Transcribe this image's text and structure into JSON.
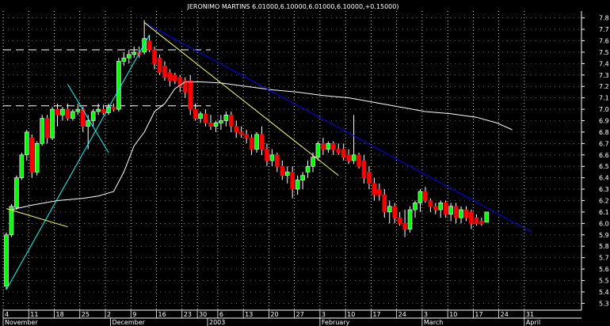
{
  "chart_data": {
    "type": "candlestick",
    "title": "JERONIMO MARTINS 6.01000,6.10000,6.01000,6.10000,+0.15000)",
    "xlabel": "",
    "ylabel": "",
    "ylim": [
      5.24,
      7.86
    ],
    "grid": true,
    "background": "#000000",
    "y_ticks": [
      7.8,
      7.7,
      7.6,
      7.5,
      7.4,
      7.3,
      7.2,
      7.1,
      7.0,
      6.9,
      6.8,
      6.7,
      6.6,
      6.5,
      6.4,
      6.3,
      6.2,
      6.1,
      6.0,
      5.9,
      5.8,
      5.7,
      5.6,
      5.5,
      5.4,
      5.3
    ],
    "x_day_labels": [
      {
        "label": "4",
        "session": 0
      },
      {
        "label": "11",
        "session": 5
      },
      {
        "label": "18",
        "session": 10
      },
      {
        "label": "25",
        "session": 15
      },
      {
        "label": "2",
        "session": 20
      },
      {
        "label": "9",
        "session": 25
      },
      {
        "label": "16",
        "session": 30
      },
      {
        "label": "23",
        "session": 35
      },
      {
        "label": "30",
        "session": 38
      },
      {
        "label": "6",
        "session": 42
      },
      {
        "label": "13",
        "session": 47
      },
      {
        "label": "20",
        "session": 52
      },
      {
        "label": "27",
        "session": 57
      },
      {
        "label": "3",
        "session": 62
      },
      {
        "label": "10",
        "session": 67
      },
      {
        "label": "17",
        "session": 72
      },
      {
        "label": "24",
        "session": 77
      },
      {
        "label": "3",
        "session": 82
      },
      {
        "label": "10",
        "session": 87
      },
      {
        "label": "17",
        "session": 92
      },
      {
        "label": "24",
        "session": 97
      },
      {
        "label": "31",
        "session": 102
      }
    ],
    "x_month_labels": [
      {
        "label": "November",
        "session": 0
      },
      {
        "label": "December",
        "session": 21
      },
      {
        "label": "2003",
        "session": 40
      },
      {
        "label": "February",
        "session": 62
      },
      {
        "label": "March",
        "session": 82
      },
      {
        "label": "April",
        "session": 102
      }
    ],
    "candles": [
      {
        "o": 5.45,
        "h": 5.92,
        "l": 5.42,
        "c": 5.9
      },
      {
        "o": 5.9,
        "h": 6.17,
        "l": 5.88,
        "c": 6.15
      },
      {
        "o": 6.14,
        "h": 6.42,
        "l": 6.12,
        "c": 6.4
      },
      {
        "o": 6.4,
        "h": 6.62,
        "l": 6.38,
        "c": 6.6
      },
      {
        "o": 6.6,
        "h": 6.82,
        "l": 6.55,
        "c": 6.8
      },
      {
        "o": 6.75,
        "h": 6.78,
        "l": 6.4,
        "c": 6.45
      },
      {
        "o": 6.45,
        "h": 6.72,
        "l": 6.42,
        "c": 6.7
      },
      {
        "o": 6.7,
        "h": 6.95,
        "l": 6.68,
        "c": 6.92
      },
      {
        "o": 6.92,
        "h": 6.95,
        "l": 6.7,
        "c": 6.75
      },
      {
        "o": 6.75,
        "h": 7.02,
        "l": 6.73,
        "c": 7.0
      },
      {
        "o": 7.0,
        "h": 7.05,
        "l": 6.85,
        "c": 6.95
      },
      {
        "o": 6.95,
        "h": 7.02,
        "l": 6.9,
        "c": 7.0
      },
      {
        "o": 7.0,
        "h": 7.05,
        "l": 6.9,
        "c": 6.92
      },
      {
        "o": 6.92,
        "h": 7.0,
        "l": 6.9,
        "c": 6.98
      },
      {
        "o": 6.98,
        "h": 7.05,
        "l": 6.95,
        "c": 7.0
      },
      {
        "o": 7.0,
        "h": 7.02,
        "l": 6.8,
        "c": 6.85
      },
      {
        "o": 6.85,
        "h": 6.95,
        "l": 6.65,
        "c": 6.9
      },
      {
        "o": 6.9,
        "h": 7.0,
        "l": 6.85,
        "c": 6.98
      },
      {
        "o": 6.98,
        "h": 7.05,
        "l": 6.95,
        "c": 7.0
      },
      {
        "o": 7.0,
        "h": 7.04,
        "l": 6.95,
        "c": 6.97
      },
      {
        "o": 6.97,
        "h": 7.05,
        "l": 6.95,
        "c": 7.02
      },
      {
        "o": 7.02,
        "h": 7.05,
        "l": 6.98,
        "c": 7.0
      },
      {
        "o": 7.0,
        "h": 7.45,
        "l": 6.98,
        "c": 7.42
      },
      {
        "o": 7.42,
        "h": 7.5,
        "l": 7.38,
        "c": 7.45
      },
      {
        "o": 7.45,
        "h": 7.52,
        "l": 7.4,
        "c": 7.48
      },
      {
        "o": 7.48,
        "h": 7.55,
        "l": 7.45,
        "c": 7.5
      },
      {
        "o": 7.5,
        "h": 7.55,
        "l": 7.45,
        "c": 7.48
      },
      {
        "o": 7.5,
        "h": 7.78,
        "l": 7.48,
        "c": 7.62
      },
      {
        "o": 7.6,
        "h": 7.65,
        "l": 7.5,
        "c": 7.52
      },
      {
        "o": 7.52,
        "h": 7.55,
        "l": 7.35,
        "c": 7.4
      },
      {
        "o": 7.45,
        "h": 7.48,
        "l": 7.3,
        "c": 7.32
      },
      {
        "o": 7.38,
        "h": 7.42,
        "l": 7.25,
        "c": 7.28
      },
      {
        "o": 7.32,
        "h": 7.35,
        "l": 7.2,
        "c": 7.25
      },
      {
        "o": 7.3,
        "h": 7.32,
        "l": 7.22,
        "c": 7.25
      },
      {
        "o": 7.28,
        "h": 7.3,
        "l": 7.15,
        "c": 7.2
      },
      {
        "o": 7.25,
        "h": 7.28,
        "l": 7.1,
        "c": 7.15
      },
      {
        "o": 7.25,
        "h": 7.3,
        "l": 6.95,
        "c": 7.0
      },
      {
        "o": 7.0,
        "h": 7.05,
        "l": 6.9,
        "c": 6.92
      },
      {
        "o": 6.92,
        "h": 6.98,
        "l": 6.88,
        "c": 6.96
      },
      {
        "o": 6.96,
        "h": 7.0,
        "l": 6.85,
        "c": 6.88
      },
      {
        "o": 6.88,
        "h": 6.95,
        "l": 6.82,
        "c": 6.85
      },
      {
        "o": 6.85,
        "h": 6.9,
        "l": 6.8,
        "c": 6.88
      },
      {
        "o": 6.88,
        "h": 6.95,
        "l": 6.82,
        "c": 6.9
      },
      {
        "o": 6.9,
        "h": 6.98,
        "l": 6.85,
        "c": 6.95
      },
      {
        "o": 6.95,
        "h": 6.98,
        "l": 6.8,
        "c": 6.85
      },
      {
        "o": 6.85,
        "h": 6.9,
        "l": 6.75,
        "c": 6.8
      },
      {
        "o": 6.8,
        "h": 6.85,
        "l": 6.75,
        "c": 6.78
      },
      {
        "o": 6.78,
        "h": 6.82,
        "l": 6.7,
        "c": 6.75
      },
      {
        "o": 6.75,
        "h": 6.78,
        "l": 6.6,
        "c": 6.65
      },
      {
        "o": 6.65,
        "h": 6.8,
        "l": 6.62,
        "c": 6.78
      },
      {
        "o": 6.78,
        "h": 6.85,
        "l": 6.6,
        "c": 6.65
      },
      {
        "o": 6.65,
        "h": 6.7,
        "l": 6.5,
        "c": 6.55
      },
      {
        "o": 6.55,
        "h": 6.65,
        "l": 6.5,
        "c": 6.6
      },
      {
        "o": 6.6,
        "h": 6.62,
        "l": 6.45,
        "c": 6.5
      },
      {
        "o": 6.5,
        "h": 6.55,
        "l": 6.38,
        "c": 6.42
      },
      {
        "o": 6.42,
        "h": 6.5,
        "l": 6.35,
        "c": 6.45
      },
      {
        "o": 6.45,
        "h": 6.5,
        "l": 6.22,
        "c": 6.3
      },
      {
        "o": 6.3,
        "h": 6.42,
        "l": 6.25,
        "c": 6.38
      },
      {
        "o": 6.38,
        "h": 6.45,
        "l": 6.3,
        "c": 6.42
      },
      {
        "o": 6.45,
        "h": 6.55,
        "l": 6.4,
        "c": 6.5
      },
      {
        "o": 6.5,
        "h": 6.62,
        "l": 6.45,
        "c": 6.58
      },
      {
        "o": 6.58,
        "h": 6.72,
        "l": 6.55,
        "c": 6.7
      },
      {
        "o": 6.7,
        "h": 6.75,
        "l": 6.6,
        "c": 6.65
      },
      {
        "o": 6.65,
        "h": 6.72,
        "l": 6.62,
        "c": 6.7
      },
      {
        "o": 6.7,
        "h": 6.72,
        "l": 6.6,
        "c": 6.65
      },
      {
        "o": 6.65,
        "h": 6.7,
        "l": 6.6,
        "c": 6.62
      },
      {
        "o": 6.65,
        "h": 6.7,
        "l": 6.55,
        "c": 6.58
      },
      {
        "o": 6.6,
        "h": 6.65,
        "l": 6.52,
        "c": 6.55
      },
      {
        "o": 6.55,
        "h": 6.95,
        "l": 6.52,
        "c": 6.6
      },
      {
        "o": 6.6,
        "h": 6.62,
        "l": 6.48,
        "c": 6.5
      },
      {
        "o": 6.55,
        "h": 6.6,
        "l": 6.35,
        "c": 6.4
      },
      {
        "o": 6.45,
        "h": 6.5,
        "l": 6.3,
        "c": 6.35
      },
      {
        "o": 6.35,
        "h": 6.4,
        "l": 6.2,
        "c": 6.25
      },
      {
        "o": 6.3,
        "h": 6.35,
        "l": 6.2,
        "c": 6.25
      },
      {
        "o": 6.25,
        "h": 6.3,
        "l": 6.05,
        "c": 6.1
      },
      {
        "o": 6.1,
        "h": 6.2,
        "l": 6.0,
        "c": 6.15
      },
      {
        "o": 6.15,
        "h": 6.18,
        "l": 6.0,
        "c": 6.05
      },
      {
        "o": 6.05,
        "h": 6.1,
        "l": 5.98,
        "c": 6.0
      },
      {
        "o": 6.0,
        "h": 6.12,
        "l": 5.88,
        "c": 5.95
      },
      {
        "o": 5.95,
        "h": 6.15,
        "l": 5.92,
        "c": 6.12
      },
      {
        "o": 6.12,
        "h": 6.2,
        "l": 6.05,
        "c": 6.18
      },
      {
        "o": 6.18,
        "h": 6.3,
        "l": 6.1,
        "c": 6.28
      },
      {
        "o": 6.28,
        "h": 6.32,
        "l": 6.18,
        "c": 6.2
      },
      {
        "o": 6.2,
        "h": 6.22,
        "l": 6.1,
        "c": 6.15
      },
      {
        "o": 6.15,
        "h": 6.18,
        "l": 6.08,
        "c": 6.12
      },
      {
        "o": 6.12,
        "h": 6.2,
        "l": 6.05,
        "c": 6.18
      },
      {
        "o": 6.18,
        "h": 6.2,
        "l": 6.05,
        "c": 6.08
      },
      {
        "o": 6.08,
        "h": 6.18,
        "l": 6.02,
        "c": 6.15
      },
      {
        "o": 6.15,
        "h": 6.18,
        "l": 6.0,
        "c": 6.05
      },
      {
        "o": 6.05,
        "h": 6.15,
        "l": 6.0,
        "c": 6.12
      },
      {
        "o": 6.12,
        "h": 6.15,
        "l": 6.02,
        "c": 6.05
      },
      {
        "o": 6.1,
        "h": 6.12,
        "l": 5.95,
        "c": 6.0
      },
      {
        "o": 6.05,
        "h": 6.08,
        "l": 5.98,
        "c": 6.0
      },
      {
        "o": 6.02,
        "h": 6.05,
        "l": 5.98,
        "c": 6.0
      },
      {
        "o": 6.01,
        "h": 6.1,
        "l": 6.01,
        "c": 6.1
      }
    ],
    "moving_average": [
      {
        "s": 1,
        "v": 6.12
      },
      {
        "s": 5,
        "v": 6.16
      },
      {
        "s": 10,
        "v": 6.2
      },
      {
        "s": 15,
        "v": 6.22
      },
      {
        "s": 18,
        "v": 6.24
      },
      {
        "s": 21,
        "v": 6.28
      },
      {
        "s": 23,
        "v": 6.45
      },
      {
        "s": 25,
        "v": 6.68
      },
      {
        "s": 27,
        "v": 6.8
      },
      {
        "s": 29,
        "v": 6.98
      },
      {
        "s": 31,
        "v": 7.05
      },
      {
        "s": 33,
        "v": 7.18
      },
      {
        "s": 35,
        "v": 7.24
      },
      {
        "s": 38,
        "v": 7.24
      },
      {
        "s": 42,
        "v": 7.23
      },
      {
        "s": 47,
        "v": 7.2
      },
      {
        "s": 52,
        "v": 7.17
      },
      {
        "s": 57,
        "v": 7.15
      },
      {
        "s": 62,
        "v": 7.12
      },
      {
        "s": 67,
        "v": 7.1
      },
      {
        "s": 72,
        "v": 7.06
      },
      {
        "s": 77,
        "v": 7.02
      },
      {
        "s": 82,
        "v": 6.98
      },
      {
        "s": 87,
        "v": 6.96
      },
      {
        "s": 92,
        "v": 6.93
      },
      {
        "s": 96,
        "v": 6.88
      },
      {
        "s": 99,
        "v": 6.82
      }
    ],
    "trendlines": [
      {
        "color": "#0000ff",
        "from": {
          "s": 27,
          "v": 7.76
        },
        "to": {
          "s": 103,
          "v": 5.92
        }
      },
      {
        "color": "#ffff66",
        "from": {
          "s": 27,
          "v": 7.76
        },
        "to": {
          "s": 65,
          "v": 6.42
        }
      },
      {
        "color": "#00ffff",
        "from": {
          "s": 0,
          "v": 5.42
        },
        "to": {
          "s": 28,
          "v": 7.65
        }
      },
      {
        "color": "#ffff66",
        "from": {
          "s": 0,
          "v": 6.13
        },
        "to": {
          "s": 12,
          "v": 5.97
        }
      },
      {
        "color": "#00ffff",
        "from": {
          "s": 12,
          "v": 7.22
        },
        "to": {
          "s": 20,
          "v": 6.62
        }
      }
    ],
    "dashed_levels": [
      {
        "v": 7.52,
        "from": 0,
        "to": 40
      },
      {
        "v": 7.03,
        "from": 0,
        "to": 40
      }
    ],
    "colors": {
      "up": "#00ff00",
      "up_outline": "#ffffff",
      "down": "#ff0000",
      "grid": "#ffffff",
      "axis": "#ffffff",
      "moving_average": "#ffffff"
    }
  }
}
